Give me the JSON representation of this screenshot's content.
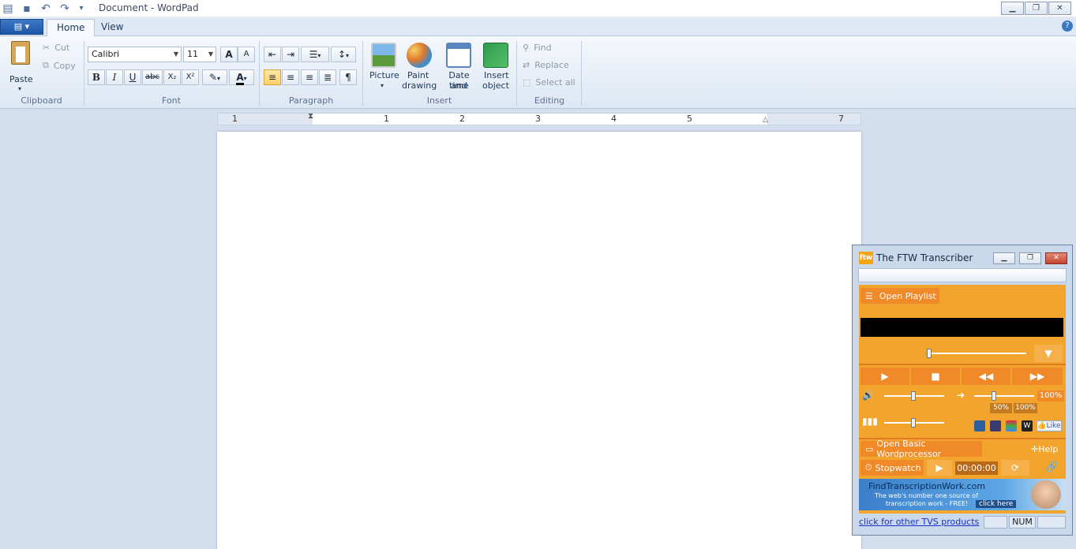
{
  "window": {
    "title": "Document - WordPad",
    "min": "▁",
    "max": "❐",
    "close": "✕"
  },
  "tabs": {
    "file": "▤ ▾",
    "home": "Home",
    "view": "View",
    "help": "?"
  },
  "clipboard": {
    "paste": "Paste",
    "cut": "Cut",
    "copy": "Copy",
    "label": "Clipboard"
  },
  "font": {
    "family": "Calibri",
    "size": "11",
    "label": "Font",
    "grow": "A",
    "shrink": "A",
    "bold": "B",
    "italic": "I",
    "underline": "U",
    "strike": "abc",
    "sub": "X₂",
    "sup": "X²",
    "highlight": "✎",
    "color": "A"
  },
  "paragraph": {
    "label": "Paragraph"
  },
  "insert": {
    "picture": "Picture",
    "paint": "Paint drawing",
    "paint_1": "Paint",
    "paint_2": "drawing",
    "datetime_1": "Date and",
    "datetime_2": "time",
    "object_1": "Insert",
    "object_2": "object",
    "label": "Insert"
  },
  "editing": {
    "find": "Find",
    "replace": "Replace",
    "select_all": "Select all",
    "label": "Editing"
  },
  "ruler": {
    "ticks": [
      "1",
      "1",
      "2",
      "3",
      "4",
      "5",
      "7"
    ]
  },
  "ftw": {
    "logo": "ftw",
    "title": "The FTW Transcriber",
    "open_playlist": "Open Playlist",
    "speed_pct": "100%",
    "speed_50": "50%",
    "speed_100": "100%",
    "like": "Like",
    "open_wordprocessor": "Open Basic Wordprocessor",
    "help": "Help",
    "stopwatch": "Stopwatch",
    "time": "00:00:00",
    "ad_line1": "FindTranscriptionWork.com",
    "ad_line2": "The web's number one source of",
    "ad_line3": "transcription work - FREE!",
    "ad_click": "click here",
    "other_products": "click for other TVS products",
    "num": "NUM"
  }
}
